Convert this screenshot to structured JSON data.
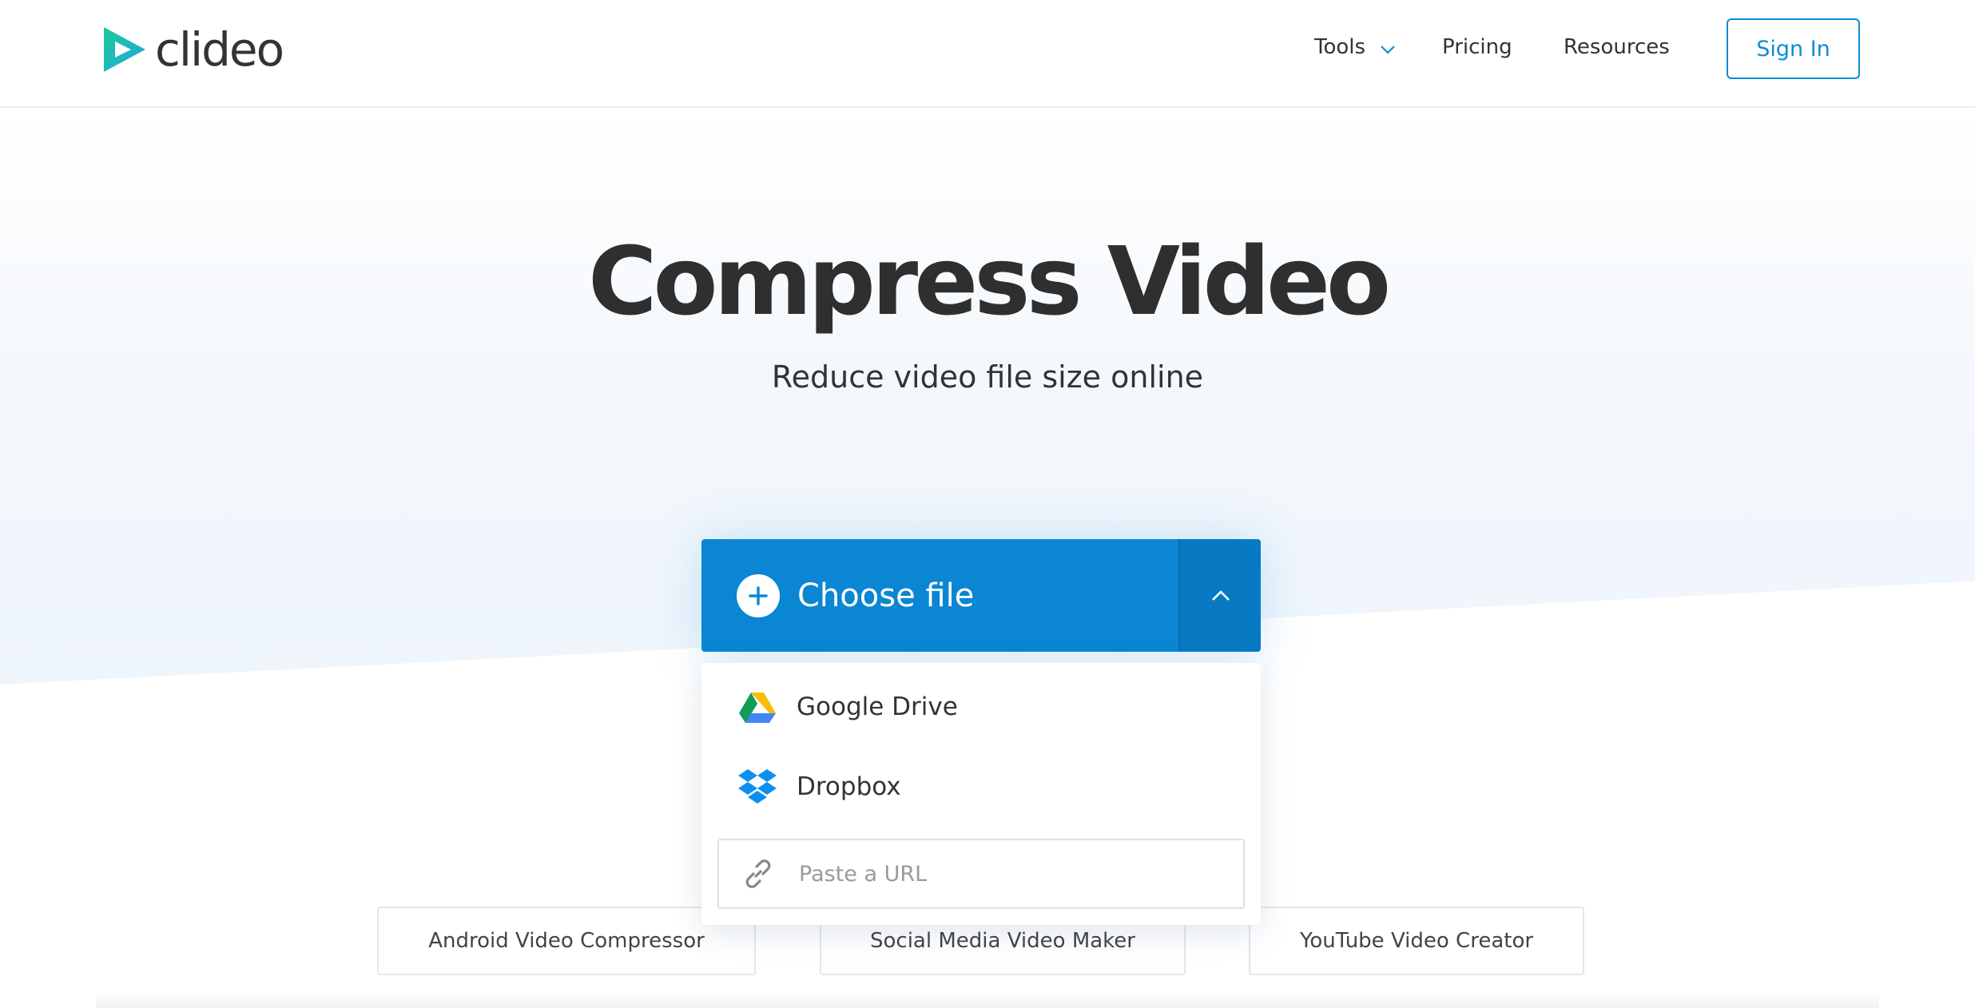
{
  "header": {
    "logo_text": "clideo",
    "nav": {
      "tools": "Tools",
      "pricing": "Pricing",
      "resources": "Resources"
    },
    "sign_in": "Sign In"
  },
  "hero": {
    "title": "Compress Video",
    "subtitle": "Reduce video file size online"
  },
  "upload": {
    "choose_file": "Choose file",
    "sources": [
      {
        "label": "Google Drive",
        "icon": "google-drive-icon"
      },
      {
        "label": "Dropbox",
        "icon": "dropbox-icon"
      }
    ],
    "url_placeholder": "Paste a URL"
  },
  "related_tools": [
    "Android Video Compressor",
    "Social Media Video Maker",
    "YouTube Video Creator"
  ],
  "colors": {
    "primary": "#0a86d2",
    "primary_dark": "#087ac4",
    "sign_in_border": "#0f8bd6",
    "text": "#333333"
  }
}
